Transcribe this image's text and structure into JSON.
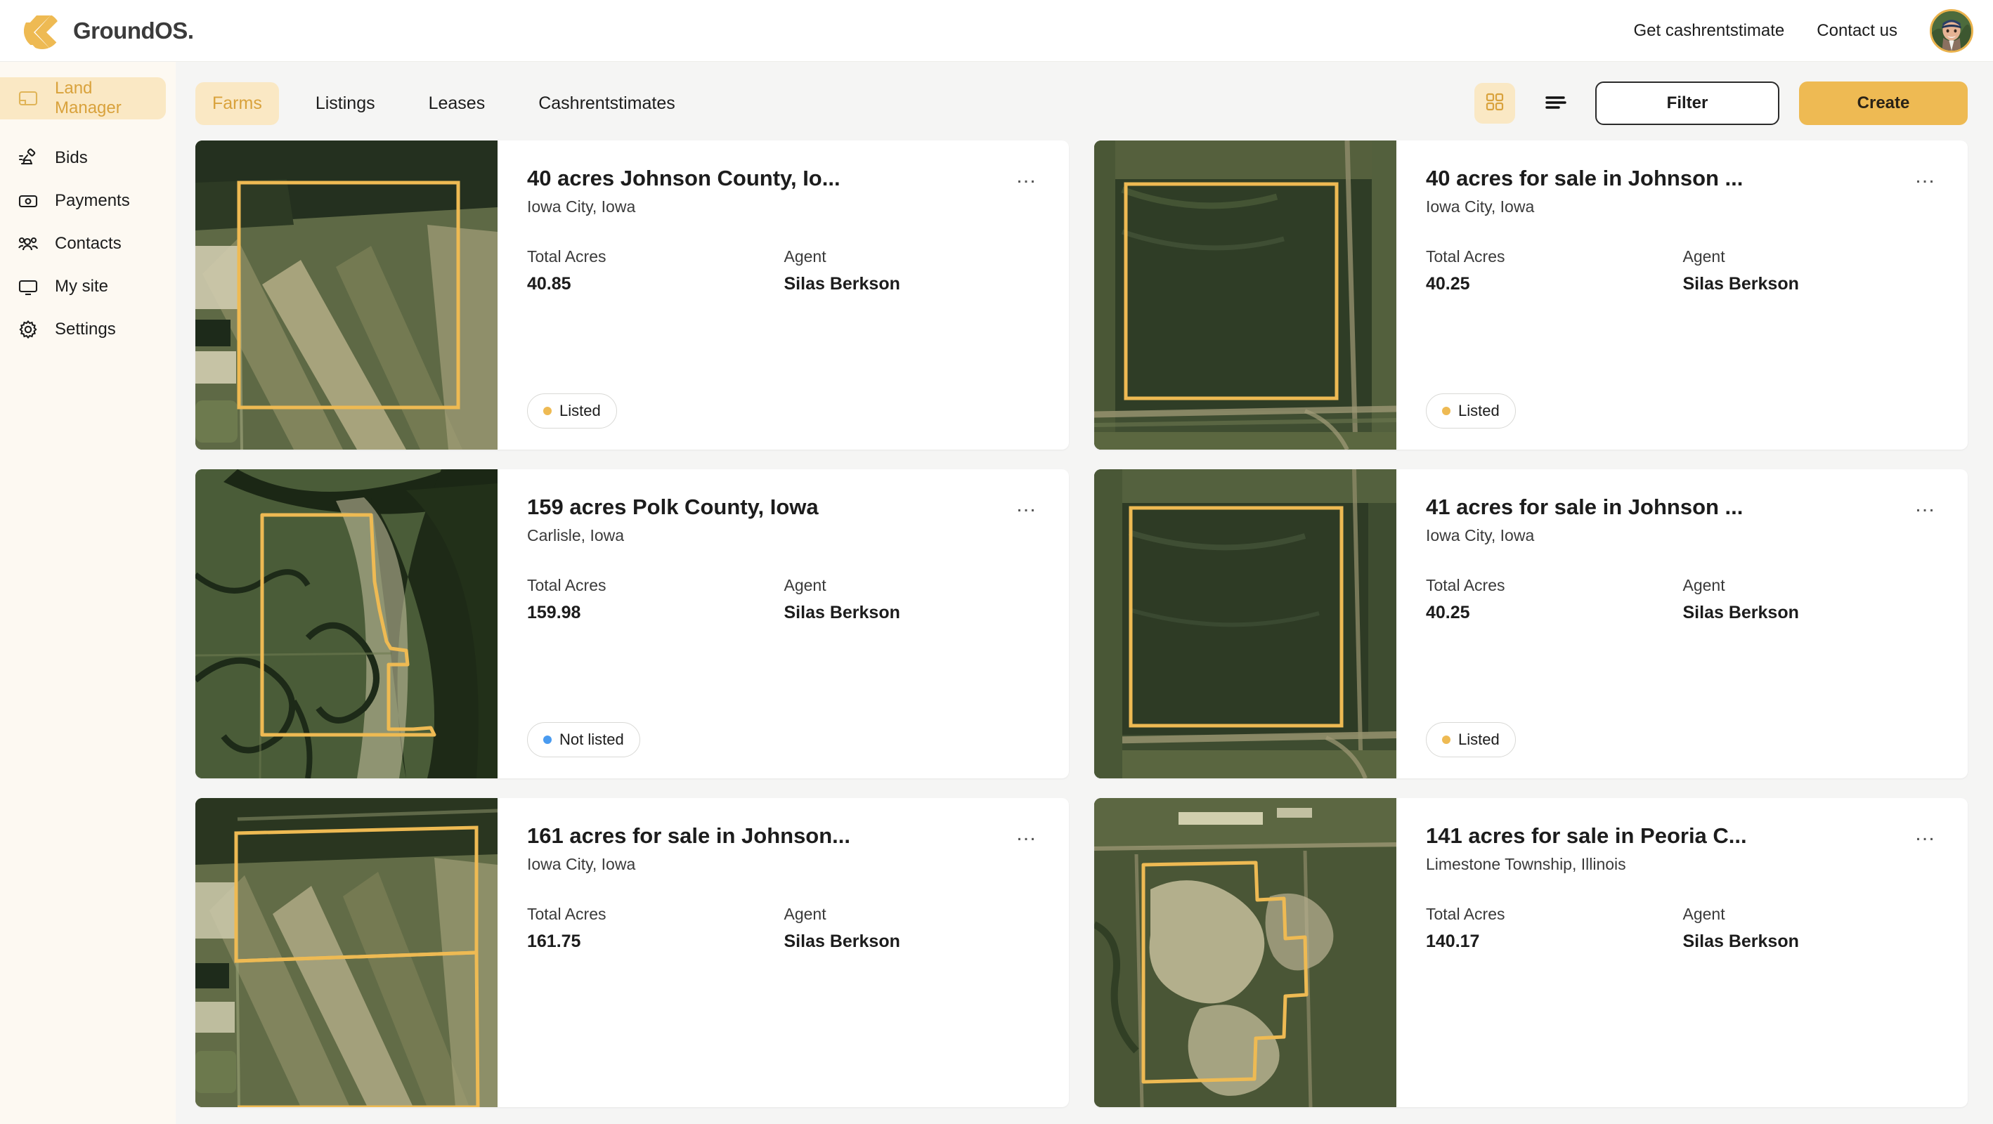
{
  "header": {
    "brand_name": "GroundOS",
    "brand_dot": ".",
    "logo_icon": "chevron-stripes-logo",
    "links": [
      {
        "label": "Get cashrentstimate",
        "name": "get-cashrentstimate"
      },
      {
        "label": "Contact us",
        "name": "contact-us"
      }
    ],
    "avatar_alt": "User avatar"
  },
  "sidebar": {
    "items": [
      {
        "label": "Land Manager",
        "icon": "layout-panel-icon",
        "active": true
      },
      {
        "label": "Bids",
        "icon": "gavel-icon",
        "active": false
      },
      {
        "label": "Payments",
        "icon": "banknote-icon",
        "active": false
      },
      {
        "label": "Contacts",
        "icon": "users-icon",
        "active": false
      },
      {
        "label": "My site",
        "icon": "monitor-icon",
        "active": false
      },
      {
        "label": "Settings",
        "icon": "gear-icon",
        "active": false
      }
    ]
  },
  "toolbar": {
    "tabs": [
      {
        "label": "Farms",
        "active": true
      },
      {
        "label": "Listings",
        "active": false
      },
      {
        "label": "Leases",
        "active": false
      },
      {
        "label": "Cashrentstimates",
        "active": false
      }
    ],
    "grid_view_icon": "grid-view-icon",
    "list_view_icon": "list-view-icon",
    "filter_label": "Filter",
    "create_label": "Create"
  },
  "labels": {
    "total_acres": "Total Acres",
    "agent": "Agent",
    "menu_glyph": "…"
  },
  "colors": {
    "accent": "#eeba53",
    "accent_text": "#d9a23c",
    "accent_soft": "#fae8c4",
    "listed_dot": "#eeba53",
    "not_listed_dot": "#4a9bf0",
    "parcel_outline": "#eeba53",
    "sidebar_bg": "#fdf9f2",
    "main_bg": "#f5f5f4"
  },
  "cards": [
    {
      "title": "40 acres Johnson County, Io...",
      "location": "Iowa City, Iowa",
      "total_acres": "40.85",
      "agent": "Silas Berkson",
      "status": "Listed",
      "status_type": "listed",
      "map": "rect-field-diagonal-strips"
    },
    {
      "title": "40 acres for sale in Johnson ...",
      "location": "Iowa City, Iowa",
      "total_acres": "40.25",
      "agent": "Silas Berkson",
      "status": "Listed",
      "status_type": "listed",
      "map": "square-field-roads"
    },
    {
      "title": "159 acres Polk County, Iowa",
      "location": "Carlisle, Iowa",
      "total_acres": "159.98",
      "agent": "Silas Berkson",
      "status": "Not listed",
      "status_type": "not-listed",
      "map": "river-bend-irregular-parcel"
    },
    {
      "title": "41 acres for sale in Johnson ...",
      "location": "Iowa City, Iowa",
      "total_acres": "40.25",
      "agent": "Silas Berkson",
      "status": "Listed",
      "status_type": "listed",
      "map": "square-field-plain"
    },
    {
      "title": "161 acres for sale in Johnson...",
      "location": "Iowa City, Iowa",
      "total_acres": "161.75",
      "agent": "Silas Berkson",
      "status": "",
      "status_type": "none",
      "map": "rect-field-split"
    },
    {
      "title": "141 acres for sale in Peoria C...",
      "location": "Limestone Township, Illinois",
      "total_acres": "140.17",
      "agent": "Silas Berkson",
      "status": "",
      "status_type": "none",
      "map": "stepped-parcel-timber"
    }
  ]
}
